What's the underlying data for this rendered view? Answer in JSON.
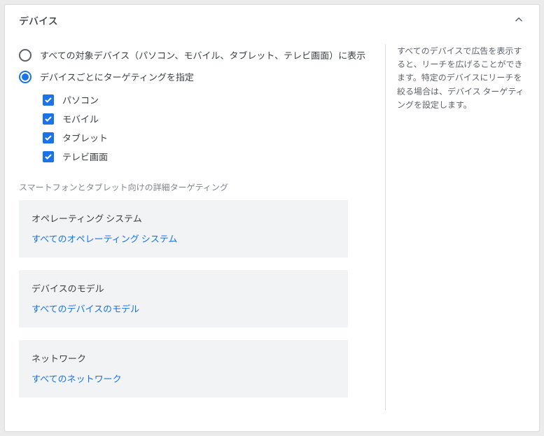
{
  "panel": {
    "title": "デバイス",
    "help": "すべてのデバイスで広告を表示すると、リーチを広げることができます。特定のデバイスにリーチを絞る場合は、デバイス ターゲティングを設定します。"
  },
  "radios": {
    "all": {
      "label": "すべての対象デバイス（パソコン、モバイル、タブレット、テレビ画面）に表示",
      "checked": false
    },
    "specific": {
      "label": "デバイスごとにターゲティングを指定",
      "checked": true
    }
  },
  "checkboxes": [
    {
      "label": "パソコン",
      "checked": true
    },
    {
      "label": "モバイル",
      "checked": true
    },
    {
      "label": "タブレット",
      "checked": true
    },
    {
      "label": "テレビ画面",
      "checked": true
    }
  ],
  "advanced_note": "スマートフォンとタブレット向けの詳細ターゲティング",
  "expanders": {
    "os": {
      "title": "オペレーティング システム",
      "value": "すべてのオペレーティング システム"
    },
    "model": {
      "title": "デバイスのモデル",
      "value": "すべてのデバイスのモデル"
    },
    "network": {
      "title": "ネットワーク",
      "value": "すべてのネットワーク"
    }
  }
}
